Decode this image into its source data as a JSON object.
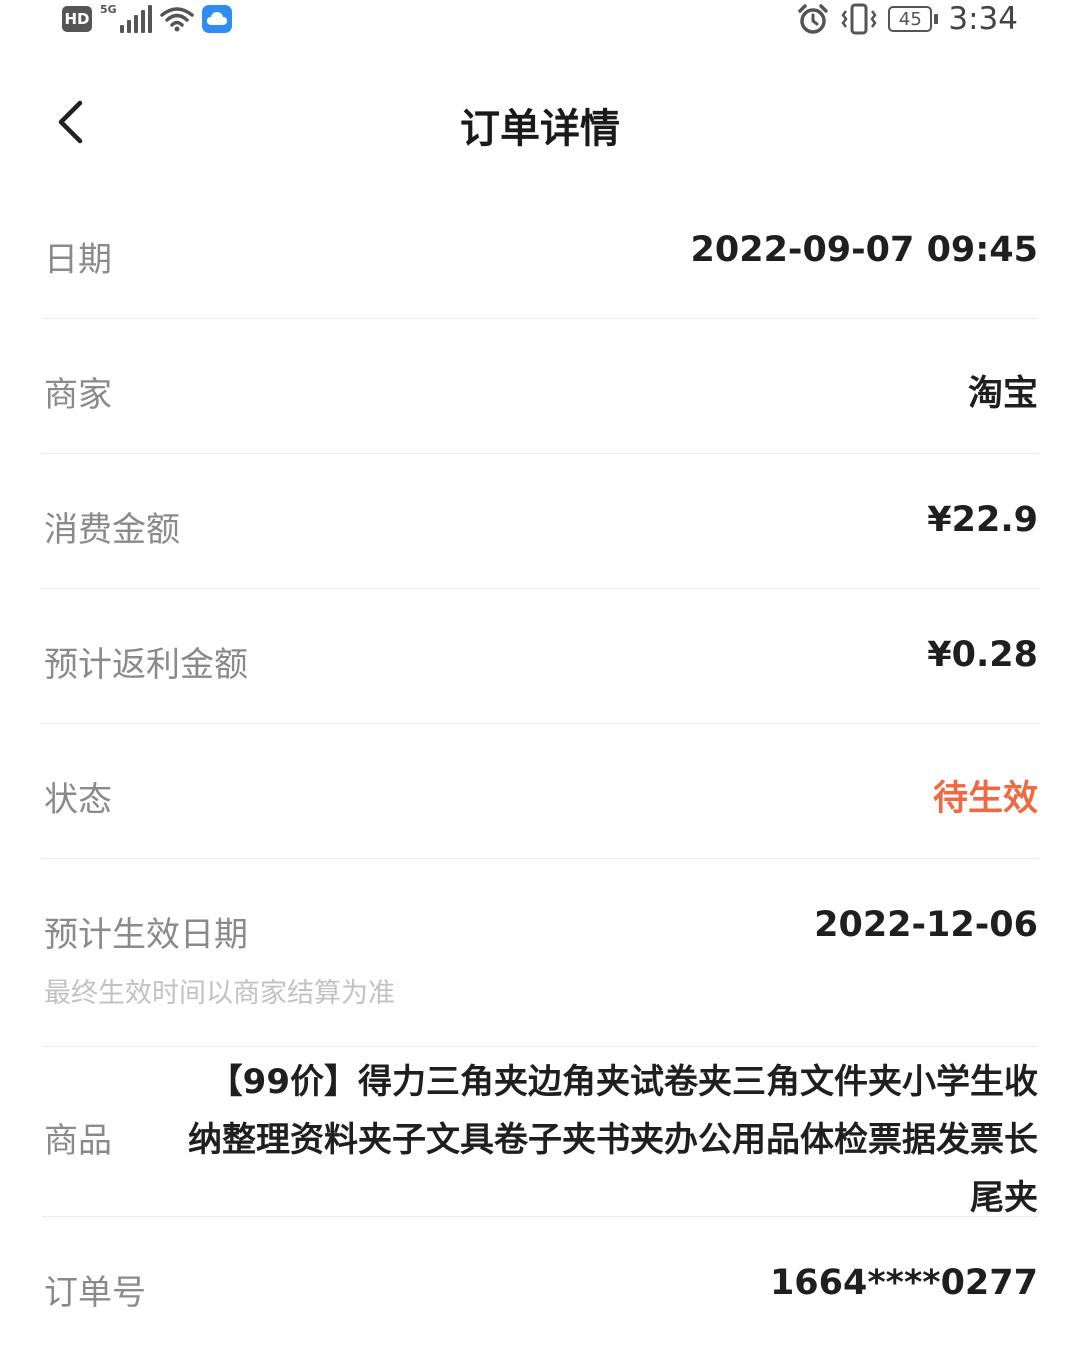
{
  "status_bar": {
    "hd": "HD",
    "network": "5G",
    "battery_level": "45",
    "time": "3:34"
  },
  "header": {
    "title": "订单详情"
  },
  "rows": [
    {
      "label": "日期",
      "value": "2022-09-07 09:45"
    },
    {
      "label": "商家",
      "value": "淘宝"
    },
    {
      "label": "消费金额",
      "value": "¥22.9"
    },
    {
      "label": "预计返利金额",
      "value": "¥0.28"
    },
    {
      "label": "状态",
      "value": "待生效"
    },
    {
      "label": "预计生效日期",
      "value": "2022-12-06",
      "hint": "最终生效时间以商家结算为准"
    },
    {
      "label": "商品",
      "value": "【99价】得力三角夹边角夹试卷夹三角文件夹小学生收纳整理资料夹子文具卷子夹书夹办公用品体检票据发票长尾夹"
    },
    {
      "label": "订单号",
      "value": "1664****0277"
    }
  ],
  "colors": {
    "status_pending": "#ef6a42",
    "label_gray": "#8a8a8a",
    "hint_gray": "#c2c2c2"
  }
}
